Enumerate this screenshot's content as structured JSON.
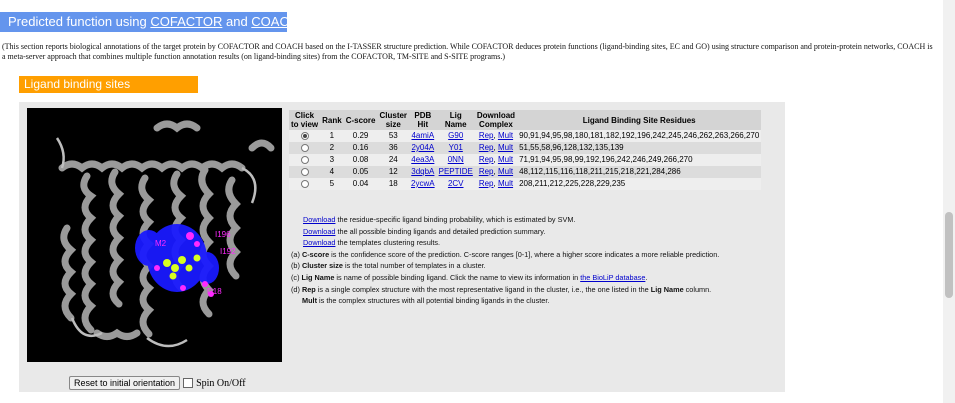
{
  "header": {
    "prefix": "Predicted function using ",
    "link1": "COFACTOR",
    "and": " and ",
    "link2": "COACH"
  },
  "intro": "(This section reports biological annotations of the target protein by COFACTOR and COACH based on the I-TASSER structure prediction. While COFACTOR deduces protein functions (ligand-binding sites, EC and GO) using structure comparison and protein-protein networks, COACH is a meta-server approach that combines multiple function annotation results (on ligand-binding sites) from the COFACTOR, TM-SITE and S-SITE programs.)",
  "subheader": "Ligand binding sites",
  "viewer": {
    "labels": [
      "I196",
      "I192",
      "M2",
      "D18"
    ],
    "reset_label": "Reset to initial orientation",
    "spin_label": "Spin On/Off"
  },
  "table": {
    "headers": {
      "click": [
        "Click",
        "to view"
      ],
      "rank": "Rank",
      "cscore": "C-score",
      "cluster": [
        "Cluster",
        "size"
      ],
      "pdb": [
        "PDB",
        "Hit"
      ],
      "lig": [
        "Lig",
        "Name"
      ],
      "download": [
        "Download",
        "Complex"
      ],
      "residues": "Ligand Binding Site Residues"
    },
    "rows": [
      {
        "rank": "1",
        "cscore": "0.29",
        "size": "53",
        "pdb": "4amiA",
        "lig": "G90",
        "rep": "Rep",
        "mult": "Mult",
        "residues": "90,91,94,95,98,180,181,182,192,196,242,245,246,262,263,266,270"
      },
      {
        "rank": "2",
        "cscore": "0.16",
        "size": "36",
        "pdb": "2y04A",
        "lig": "Y01",
        "rep": "Rep",
        "mult": "Mult",
        "residues": "51,55,58,96,128,132,135,139"
      },
      {
        "rank": "3",
        "cscore": "0.08",
        "size": "24",
        "pdb": "4ea3A",
        "lig": "0NN",
        "rep": "Rep",
        "mult": "Mult",
        "residues": "71,91,94,95,98,99,192,196,242,246,249,266,270"
      },
      {
        "rank": "4",
        "cscore": "0.05",
        "size": "12",
        "pdb": "3dqbA",
        "lig": "PEPTIDE",
        "rep": "Rep",
        "mult": "Mult",
        "residues": "48,112,115,116,118,211,215,218,221,284,286"
      },
      {
        "rank": "5",
        "cscore": "0.04",
        "size": "18",
        "pdb": "2ycwA",
        "lig": "2CV",
        "rep": "Rep",
        "mult": "Mult",
        "residues": "208,211,212,225,228,229,235"
      }
    ]
  },
  "notes": {
    "dl1_link": "Download",
    "dl1_text": " the residue-specific ligand binding probability, which is estimated by SVM.",
    "dl2_link": "Download",
    "dl2_text": " the all possible binding ligands and detailed prediction summary.",
    "dl3_link": "Download",
    "dl3_text": " the templates clustering results.",
    "a_prefix": "(a) ",
    "a_bold": "C-score",
    "a_text": " is the confidence score of the prediction. C-score ranges [0-1], where a higher score indicates a more reliable prediction.",
    "b_prefix": "(b) ",
    "b_bold": "Cluster size",
    "b_text": " is the total number of templates in a cluster.",
    "c_prefix": "(c) ",
    "c_bold": "Lig Name",
    "c_text": " is name of possible binding ligand. Click the name to view its information in ",
    "c_link": "the BioLiP database",
    "c_end": ".",
    "d_prefix": "(d) ",
    "d_bold": "Rep",
    "d_text": " is a single complex structure with the most representative ligand in the cluster, i.e., the one listed in the ",
    "d_bold2": "Lig Name",
    "d_end": " column.",
    "e_bold": "Mult",
    "e_text": " is the complex structures with all potential binding ligands in the cluster."
  },
  "colors": {
    "header_bg": "#6495ed",
    "subheader_bg": "#ff9f00",
    "panel_bg": "#e9e9e9",
    "link": "#0000cc",
    "ligand_site_blue": "#1a1aff",
    "ligand_yellow": "#d8ff20",
    "label_magenta": "#ff2aff"
  }
}
